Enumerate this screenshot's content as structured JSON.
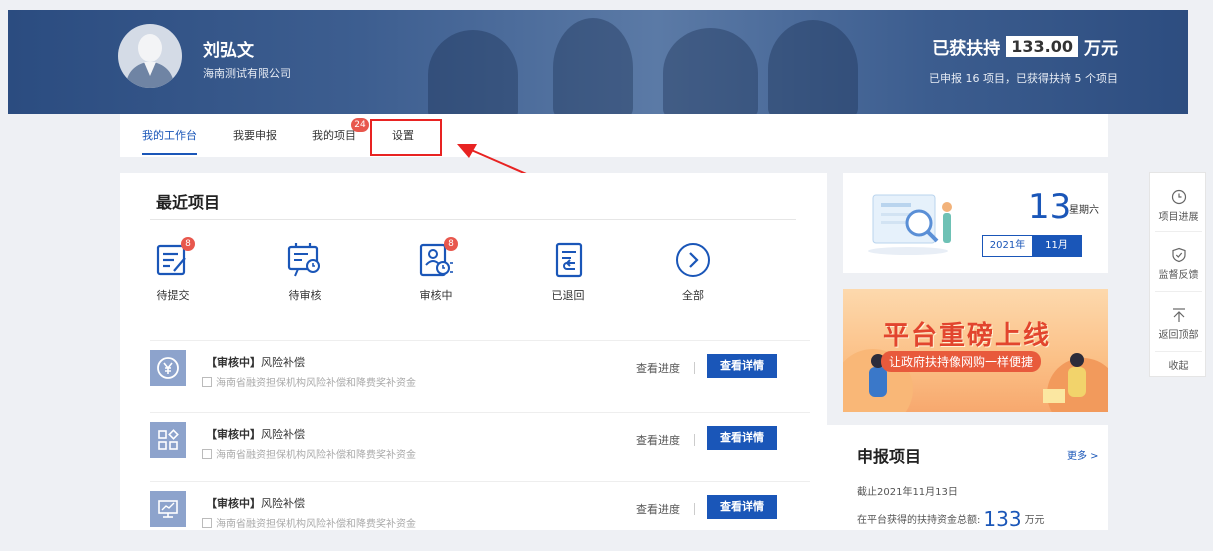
{
  "header": {
    "user_name": "刘弘文",
    "company": "海南测试有限公司",
    "support_prefix": "已获扶持",
    "support_amount": "133.00",
    "support_unit": "万元",
    "support_detail": "已申报 16 项目，已获得扶持 5 个项目"
  },
  "nav": {
    "tabs": [
      {
        "label": "我的工作台",
        "active": true
      },
      {
        "label": "我要申报"
      },
      {
        "label": "我的项目",
        "badge": "24"
      },
      {
        "label": "设置"
      }
    ]
  },
  "recent": {
    "title": "最近项目",
    "categories": [
      {
        "label": "待提交",
        "badge": "8",
        "icon": "edit-doc-icon"
      },
      {
        "label": "待审核",
        "icon": "review-board-icon"
      },
      {
        "label": "审核中",
        "badge": "8",
        "icon": "reviewing-icon"
      },
      {
        "label": "已退回",
        "icon": "returned-doc-icon"
      },
      {
        "label": "全部",
        "icon": "chevron-right-circle-icon"
      }
    ],
    "projects": [
      {
        "status": "【审核中】",
        "name": "风险补偿",
        "desc": "海南省融资担保机构风险补偿和降费奖补资金",
        "progress": "查看进度",
        "detail": "查看详情",
        "icon": "yen-icon"
      },
      {
        "status": "【审核中】",
        "name": "风险补偿",
        "desc": "海南省融资担保机构风险补偿和降费奖补资金",
        "progress": "查看进度",
        "detail": "查看详情",
        "icon": "apps-icon"
      },
      {
        "status": "【审核中】",
        "name": "风险补偿",
        "desc": "海南省融资担保机构风险补偿和降费奖补资金",
        "progress": "查看进度",
        "detail": "查看详情",
        "icon": "monitor-icon"
      }
    ]
  },
  "calendar": {
    "day": "13",
    "weekday": "星期六",
    "year": "2021年",
    "month": "11月"
  },
  "promo": {
    "title": "平台重磅上线",
    "subtitle": "让政府扶持像网购一样便捷"
  },
  "apply": {
    "title": "申报项目",
    "more": "更多 >",
    "date_line": "截止2021年11月13日",
    "total_label": "在平台获得的扶持资金总额:",
    "total_value": "133",
    "total_unit": "万元"
  },
  "sidebar": {
    "items": [
      {
        "label": "项目进展",
        "icon": "clock-icon"
      },
      {
        "label": "监督反馈",
        "icon": "shield-check-icon"
      },
      {
        "label": "返回顶部",
        "icon": "back-to-top-icon"
      },
      {
        "label": "收起"
      }
    ]
  },
  "colors": {
    "primary": "#1a56b8",
    "badge": "#e8574d",
    "highlight": "#e82322",
    "banner": "#2b4c80"
  }
}
